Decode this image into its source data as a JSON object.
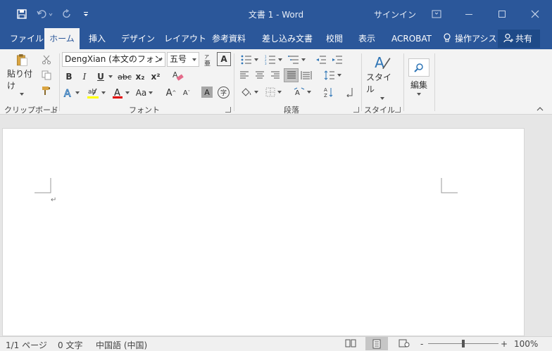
{
  "window": {
    "title": "文書 1  -  Word",
    "signin": "サインイン"
  },
  "tabs": [
    "ファイル",
    "ホーム",
    "挿入",
    "デザイン",
    "レイアウト",
    "参考資料",
    "差し込み文書",
    "校閲",
    "表示",
    "ACROBAT"
  ],
  "active_tab": "ホーム",
  "tell_me": "操作アシス",
  "share": "共有",
  "ribbon": {
    "clipboard": {
      "paste": "貼り付け",
      "label": "クリップボード"
    },
    "font": {
      "label": "フォント",
      "name": "DengXian (本文のフォント",
      "size": "五号",
      "bold": "B",
      "italic": "I",
      "underline": "U",
      "strike": "abc",
      "subscript": "x₂",
      "superscript": "x²",
      "change_case": "Aa",
      "grow": "A",
      "shrink": "A",
      "char_shade": "A",
      "enclosed": "字"
    },
    "paragraph": {
      "label": "段落"
    },
    "styles": {
      "button": "スタイル",
      "label": "スタイル"
    },
    "editing": {
      "button": "編集"
    }
  },
  "status": {
    "page": "1/1 ページ",
    "words": "0 文字",
    "language": "中国語 (中国)",
    "zoom_minus": "-",
    "zoom_plus": "+",
    "zoom": "100%",
    "zoom_level": 0.5
  },
  "document": {
    "paragraph_mark": "↵"
  }
}
